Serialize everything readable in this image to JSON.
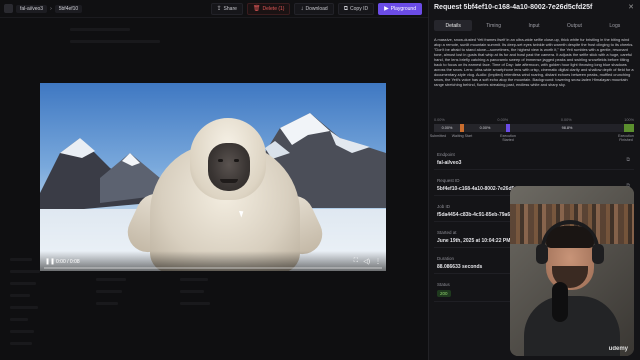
{
  "topbar": {
    "crumbs": [
      "fal-ai/veo3",
      "5bf4ef10"
    ],
    "buttons": {
      "share": "Share",
      "delete": "Delete (1)",
      "download": "Download",
      "copy_id": "Copy ID",
      "playground": "Playground"
    }
  },
  "video": {
    "time": "0:00 / 0:08",
    "progress": 0.0
  },
  "request": {
    "title": "Request 5bf4ef10-c168-4a10-8002-7e26d5cfd25f",
    "tabs": [
      "Details",
      "Timing",
      "Input",
      "Output",
      "Logs"
    ],
    "active_tab": "Details",
    "prompt": "A massive, snow-dusted Yeti frames itself in an ultra-wide selfie close-up, thick white fur bristling in the biting wind atop a remote, sunlit mountain summit. Its deep-set eyes twinkle with warmth despite the frost clinging to its cheeks. \"Don't be afraid to stand alone—sometimes, the highest view is worth it,\" the Yeti rumbles with a gentle, resonant tone, almost lost in gusts that whip at its fur and howl past the camera. It adjusts the selfie stick with a huge, careful hand, the lens briefly catching a panoramic sweep of immense jagged peaks and swirling snowfields before tilting back to focus on its earnest face. Time of Day: late afternoon, with golden hour light throwing long blue shadows across the snow. Lens: ultra-wide smartphone lens with crisp, cinematic digital clarity and shallow depth of field for a documentary-style vlog. Audio: (implied) relentless wind roaring, distant echoes between peaks, muffled crunching snow, the Yeti's voice has a soft echo atop the mountain. Background: towering snow-laden Himalayan mountain range stretching behind, flurries streaking past, endless white and sharp sky.",
    "timeline": {
      "top_labels": [
        "0.00%",
        "0.00%",
        "0.00%",
        "100%"
      ],
      "segments": [
        "0.00%",
        "0.00%",
        "98.8%"
      ],
      "stages": [
        "Submitted",
        "Waiting Start",
        "Execution Started",
        "Execution Finished"
      ]
    },
    "fields": [
      {
        "label": "Endpoint",
        "value": "fal-ai/veo3"
      },
      {
        "label": "Request ID",
        "value": "5bf4ef10-c168-4a10-8002-7e26d5cfd25f"
      },
      {
        "label": "Job ID",
        "value": "f5da4454-c83b-4c91-85eb-79a6837f952f"
      },
      {
        "label": "Started at",
        "value": "June 19th, 2025 at 10:04:22 PM GMT+3"
      },
      {
        "label": "Duration",
        "value": "88.086633 seconds"
      }
    ],
    "status": {
      "label": "Status",
      "value": "200"
    }
  },
  "webcam": {
    "watermark": "udemy"
  },
  "colors": {
    "accent": "#6b4ce6",
    "danger": "#e05757",
    "success": "#8fd36d"
  }
}
